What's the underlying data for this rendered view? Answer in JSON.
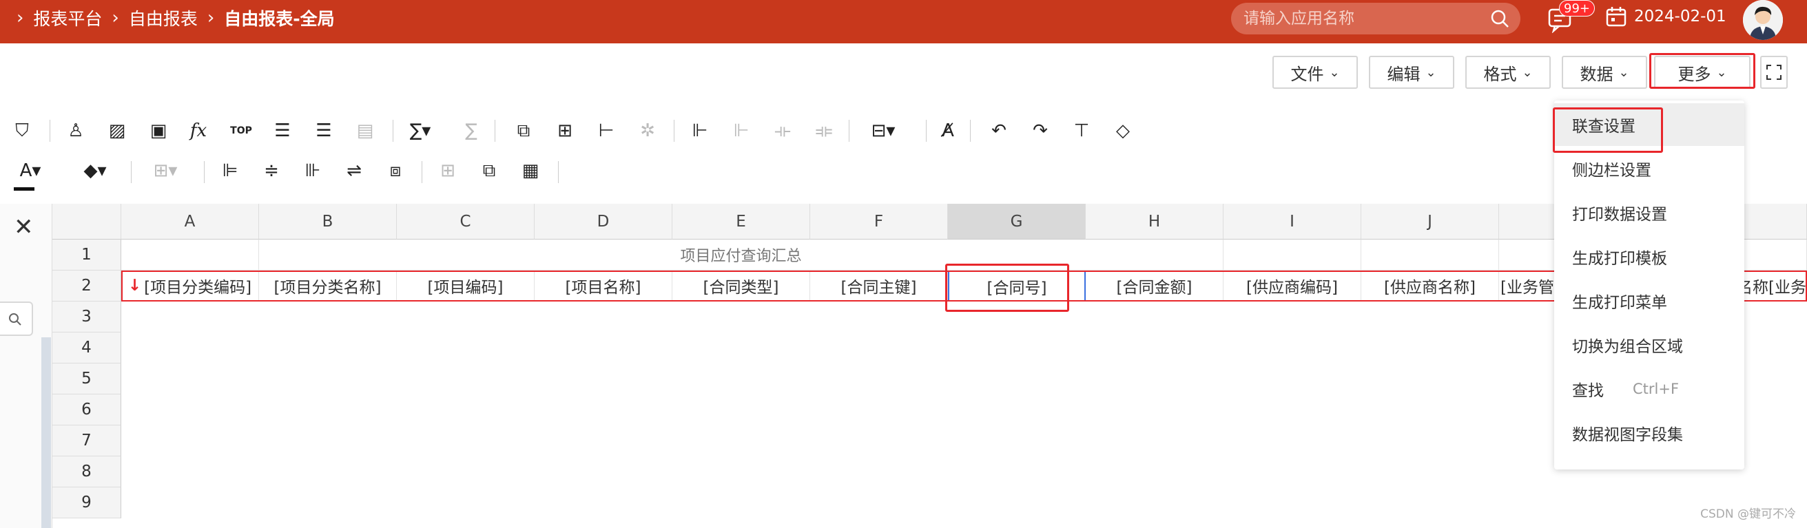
{
  "breadcrumb": [
    "报表平台",
    "自由报表",
    "自由报表-全局"
  ],
  "search": {
    "placeholder": "请输入应用名称"
  },
  "notifications": {
    "badge": "99+"
  },
  "date": "2024-02-01",
  "menus": [
    {
      "label": "文件"
    },
    {
      "label": "编辑"
    },
    {
      "label": "格式"
    },
    {
      "label": "数据"
    },
    {
      "label": "更多"
    }
  ],
  "toolbar_icons": [
    "filter-icon",
    "person-icon",
    "image-icon",
    "chart-image-icon",
    "function-icon",
    "top-n-icon",
    "group-rows-icon",
    "group-rows-alt-icon",
    "subtotal-icon",
    "sum-icon",
    "sum-clear-icon",
    "copy-cell-icon",
    "layout-icon",
    "tree-icon",
    "link-nodes-icon",
    "freeze-icon",
    "unfreeze-icon",
    "split-icon",
    "unsplit-icon",
    "column-width-icon",
    "clear-format-icon",
    "undo-icon",
    "redo-icon",
    "format-painter-icon",
    "eraser-icon",
    "font-color-icon",
    "fill-color-icon",
    "border-icon",
    "align-left-icon",
    "align-center-icon",
    "align-right-icon",
    "wrap-text-icon",
    "auto-fit-icon",
    "merge-icon",
    "unmerge-icon",
    "table-icon"
  ],
  "columns": [
    "A",
    "B",
    "C",
    "D",
    "E",
    "F",
    "G",
    "H",
    "I",
    "J"
  ],
  "selected_column": "G",
  "rows": [
    "1",
    "2",
    "3",
    "4",
    "5",
    "6",
    "7",
    "8",
    "9"
  ],
  "title_cell": "项目应付查询汇总",
  "row2": [
    "[项目分类编码]",
    "[项目分类名称]",
    "[项目编码]",
    "[项目名称]",
    "[合同类型]",
    "[合同主键]",
    "[合同号]",
    "[合同金额]",
    "[供应商编码]",
    "[供应商名称]",
    "[业务管",
    "名称[业务"
  ],
  "dropdown": [
    {
      "label": "联查设置"
    },
    {
      "label": "侧边栏设置"
    },
    {
      "label": "打印数据设置"
    },
    {
      "label": "生成打印模板"
    },
    {
      "label": "生成打印菜单"
    },
    {
      "label": "切换为组合区域"
    },
    {
      "label": "查找",
      "shortcut": "Ctrl+F"
    },
    {
      "label": "数据视图字段集"
    }
  ],
  "watermark": "CSDN @键可不冷",
  "colors": {
    "topbar": "#c8381c",
    "highlight": "#e8262b",
    "selection": "#3a6fe0"
  }
}
